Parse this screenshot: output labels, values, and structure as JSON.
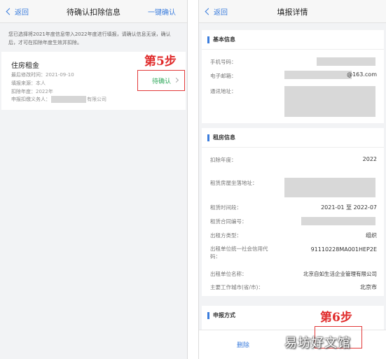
{
  "left": {
    "nav": {
      "back": "返回",
      "title": "待确认扣除信息",
      "action": "一键确认"
    },
    "notice": "您已选择将2021年度信息带入2022年度进行填报，请确认信息无误，确认后，才可在扣除年度生效并扣除。",
    "card": {
      "title": "住房租金",
      "last_modified_label": "最后修改时间：",
      "last_modified_value": "2021-09-10",
      "source_label": "填报来源：",
      "source_value": "本人",
      "year_label": "扣除年度：",
      "year_value": "2022年",
      "payer_label": "申报扣缴义务人：",
      "payer_suffix": "有限公司",
      "confirm_label": "待确认"
    },
    "step_label": "第5步"
  },
  "right": {
    "nav": {
      "back": "返回",
      "title": "填报详情"
    },
    "basic": {
      "title": "基本信息",
      "phone_label": "手机号码：",
      "email_label": "电子邮箱：",
      "email_suffix": "@163.com",
      "address_label": "通讯地址："
    },
    "rent": {
      "title": "租房信息",
      "year_label": "扣除年度：",
      "year_value": "2022",
      "house_addr_label": "租赁房屋坐落地址：",
      "period_label": "租赁时间段：",
      "period_value": "2021-01 至 2022-07",
      "contract_label": "租赁合同编号：",
      "lessor_type_label": "出租方类型：",
      "lessor_type_value": "组织",
      "credit_code_label_1": "出租单位统一社会信用代",
      "credit_code_label_2": "码：",
      "credit_code_value": "91110228MA001HEP2E",
      "lessor_name_label": "出租单位名称：",
      "lessor_name_value": "北京自如生活企业管理有限公司",
      "city_label": "主要工作城市(省/市)：",
      "city_value": "北京市"
    },
    "filing": {
      "title": "申报方式"
    },
    "bottom": {
      "delete": "删除"
    },
    "step_label": "第6步"
  },
  "watermark": "易坊好文馆",
  "colors": {
    "accent": "#3b7ddd",
    "highlight": "#e23a3a",
    "pending": "#2fa85a"
  }
}
